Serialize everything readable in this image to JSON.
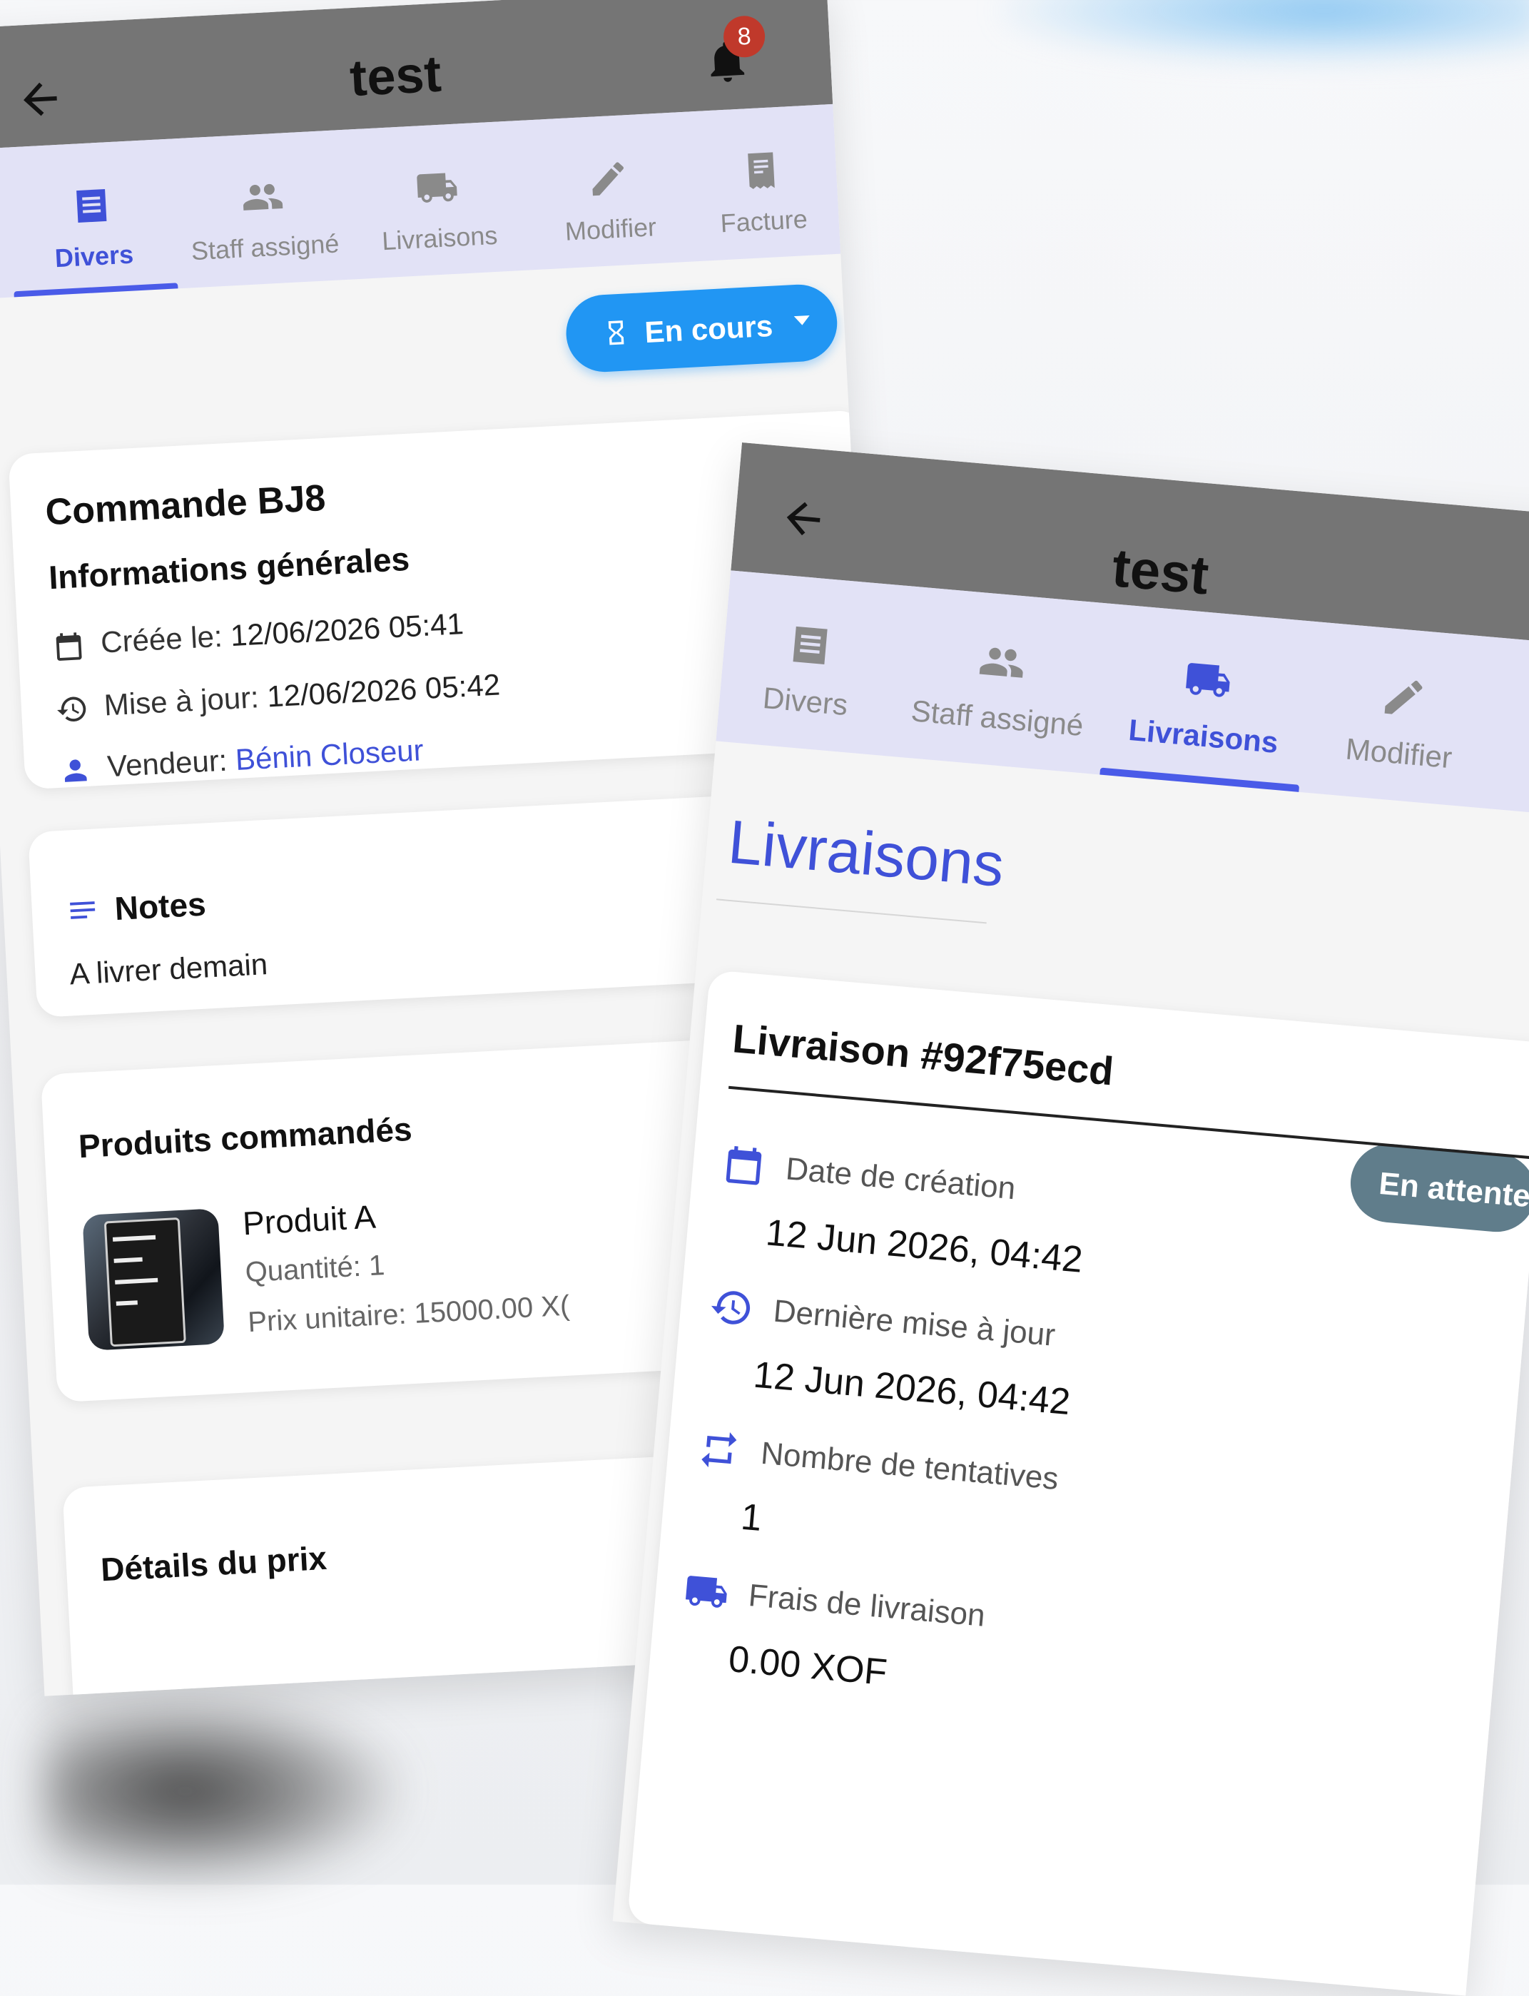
{
  "left_screen": {
    "app_bar": {
      "title": "test",
      "notification_count": "8"
    },
    "tabs": [
      {
        "label": "Divers",
        "icon": "list-alt-icon",
        "active": true
      },
      {
        "label": "Staff assigné",
        "icon": "people-icon",
        "active": false
      },
      {
        "label": "Livraisons",
        "icon": "truck-icon",
        "active": false
      },
      {
        "label": "Modifier",
        "icon": "pencil-icon",
        "active": false
      },
      {
        "label": "Facture",
        "icon": "receipt-icon",
        "active": false
      }
    ],
    "status_button": {
      "label": "En cours",
      "icon": "hourglass-icon",
      "color": "#2196f3"
    },
    "order_card": {
      "title": "Commande BJ8",
      "section": "Informations générales",
      "created_label": "Créée le:",
      "created_value": "12/06/2026 05:41",
      "updated_label": "Mise à jour:",
      "updated_value": "12/06/2026 05:42",
      "seller_label": "Vendeur:",
      "seller_value": "Bénin Closeur"
    },
    "notes_card": {
      "title": "Notes",
      "text": "A livrer demain"
    },
    "products_card": {
      "title": "Produits commandés",
      "product_name": "Produit A",
      "quantity": "Quantité: 1",
      "unit_price": "Prix unitaire: 15000.00 X("
    },
    "price_card": {
      "title": "Détails du prix"
    }
  },
  "right_screen": {
    "app_bar": {
      "title": "test"
    },
    "tabs": [
      {
        "label": "Divers",
        "icon": "list-alt-icon",
        "active": false
      },
      {
        "label": "Staff assigné",
        "icon": "people-icon",
        "active": false
      },
      {
        "label": "Livraisons",
        "icon": "truck-icon",
        "active": true
      },
      {
        "label": "Modifier",
        "icon": "pencil-icon",
        "active": false
      }
    ],
    "section_title": "Livraisons",
    "delivery_card": {
      "title": "Livraison #92f75ecd",
      "status": "En attente",
      "status_color": "#607d8b",
      "fields": [
        {
          "label": "Date de création",
          "value": "12 Jun 2026, 04:42",
          "icon": "calendar-icon"
        },
        {
          "label": "Dernière mise à jour",
          "value": "12 Jun 2026, 04:42",
          "icon": "history-icon"
        },
        {
          "label": "Nombre de tentatives",
          "value": "1",
          "icon": "repeat-icon"
        },
        {
          "label": "Frais de livraison",
          "value": "0.00 XOF",
          "icon": "truck-icon"
        }
      ]
    }
  },
  "colors": {
    "accent": "#3f51d8",
    "app_bar": "#757575",
    "tab_bar": "#e2e2f6"
  }
}
